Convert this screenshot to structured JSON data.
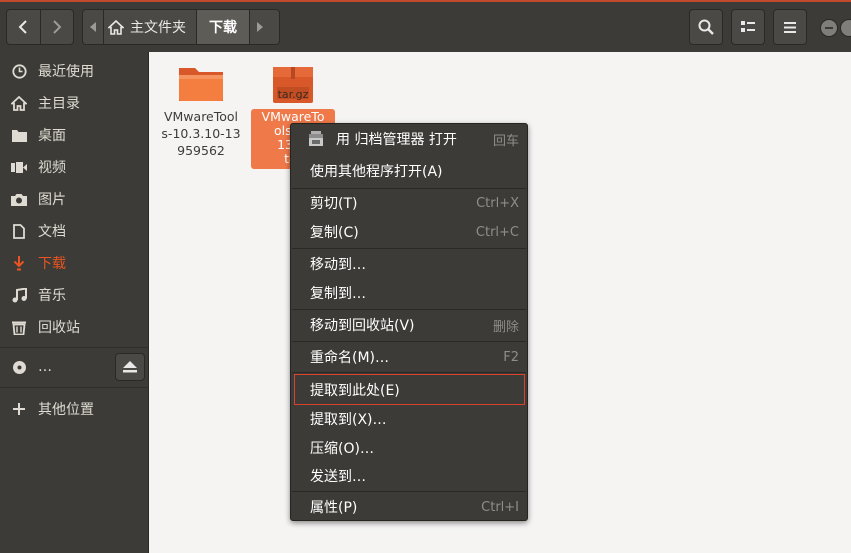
{
  "header": {
    "path_home": "主文件夹",
    "path_current": "下载"
  },
  "sidebar": {
    "items": [
      {
        "label": "最近使用",
        "icon": "clock-icon"
      },
      {
        "label": "主目录",
        "icon": "home-icon"
      },
      {
        "label": "桌面",
        "icon": "folder-icon"
      },
      {
        "label": "视频",
        "icon": "video-icon"
      },
      {
        "label": "图片",
        "icon": "camera-icon"
      },
      {
        "label": "文档",
        "icon": "document-icon"
      },
      {
        "label": "下载",
        "icon": "download-icon",
        "active": true
      },
      {
        "label": "音乐",
        "icon": "music-icon"
      },
      {
        "label": "回收站",
        "icon": "trash-icon"
      },
      {
        "label": "…",
        "icon": "disc-icon"
      },
      {
        "label": "其他位置",
        "icon": "plus-icon"
      }
    ]
  },
  "files": [
    {
      "label": "VMwareTools-10.3.10-13959562",
      "type": "folder"
    },
    {
      "label": "VMwareTools-10.3.10-13959562.tar.gz",
      "type": "archive",
      "badge": "tar.gz",
      "visible_label_lines": [
        "VMwareTo",
        "ols-10",
        "1395",
        "tar"
      ]
    }
  ],
  "context_menu": {
    "items": [
      {
        "label": "用 归档管理器 打开",
        "shortcut": "回车"
      },
      {
        "label": "使用其他程序打开(A)",
        "shortcut": ""
      },
      {
        "label": "剪切(T)",
        "shortcut": "Ctrl+X"
      },
      {
        "label": "复制(C)",
        "shortcut": "Ctrl+C"
      },
      {
        "label": "移动到…",
        "shortcut": ""
      },
      {
        "label": "复制到…",
        "shortcut": ""
      },
      {
        "label": "移动到回收站(V)",
        "shortcut": "删除"
      },
      {
        "label": "重命名(M)…",
        "shortcut": "F2"
      },
      {
        "label": "提取到此处(E)",
        "shortcut": "",
        "highlighted": true
      },
      {
        "label": "提取到(X)…",
        "shortcut": ""
      },
      {
        "label": "压缩(O)…",
        "shortcut": ""
      },
      {
        "label": "发送到…",
        "shortcut": ""
      },
      {
        "label": "属性(P)",
        "shortcut": "Ctrl+I"
      }
    ]
  },
  "colors": {
    "accent": "#e95420",
    "header_bg": "#3c3b37",
    "selection": "#f0794a",
    "highlight_border": "#d8432a"
  }
}
